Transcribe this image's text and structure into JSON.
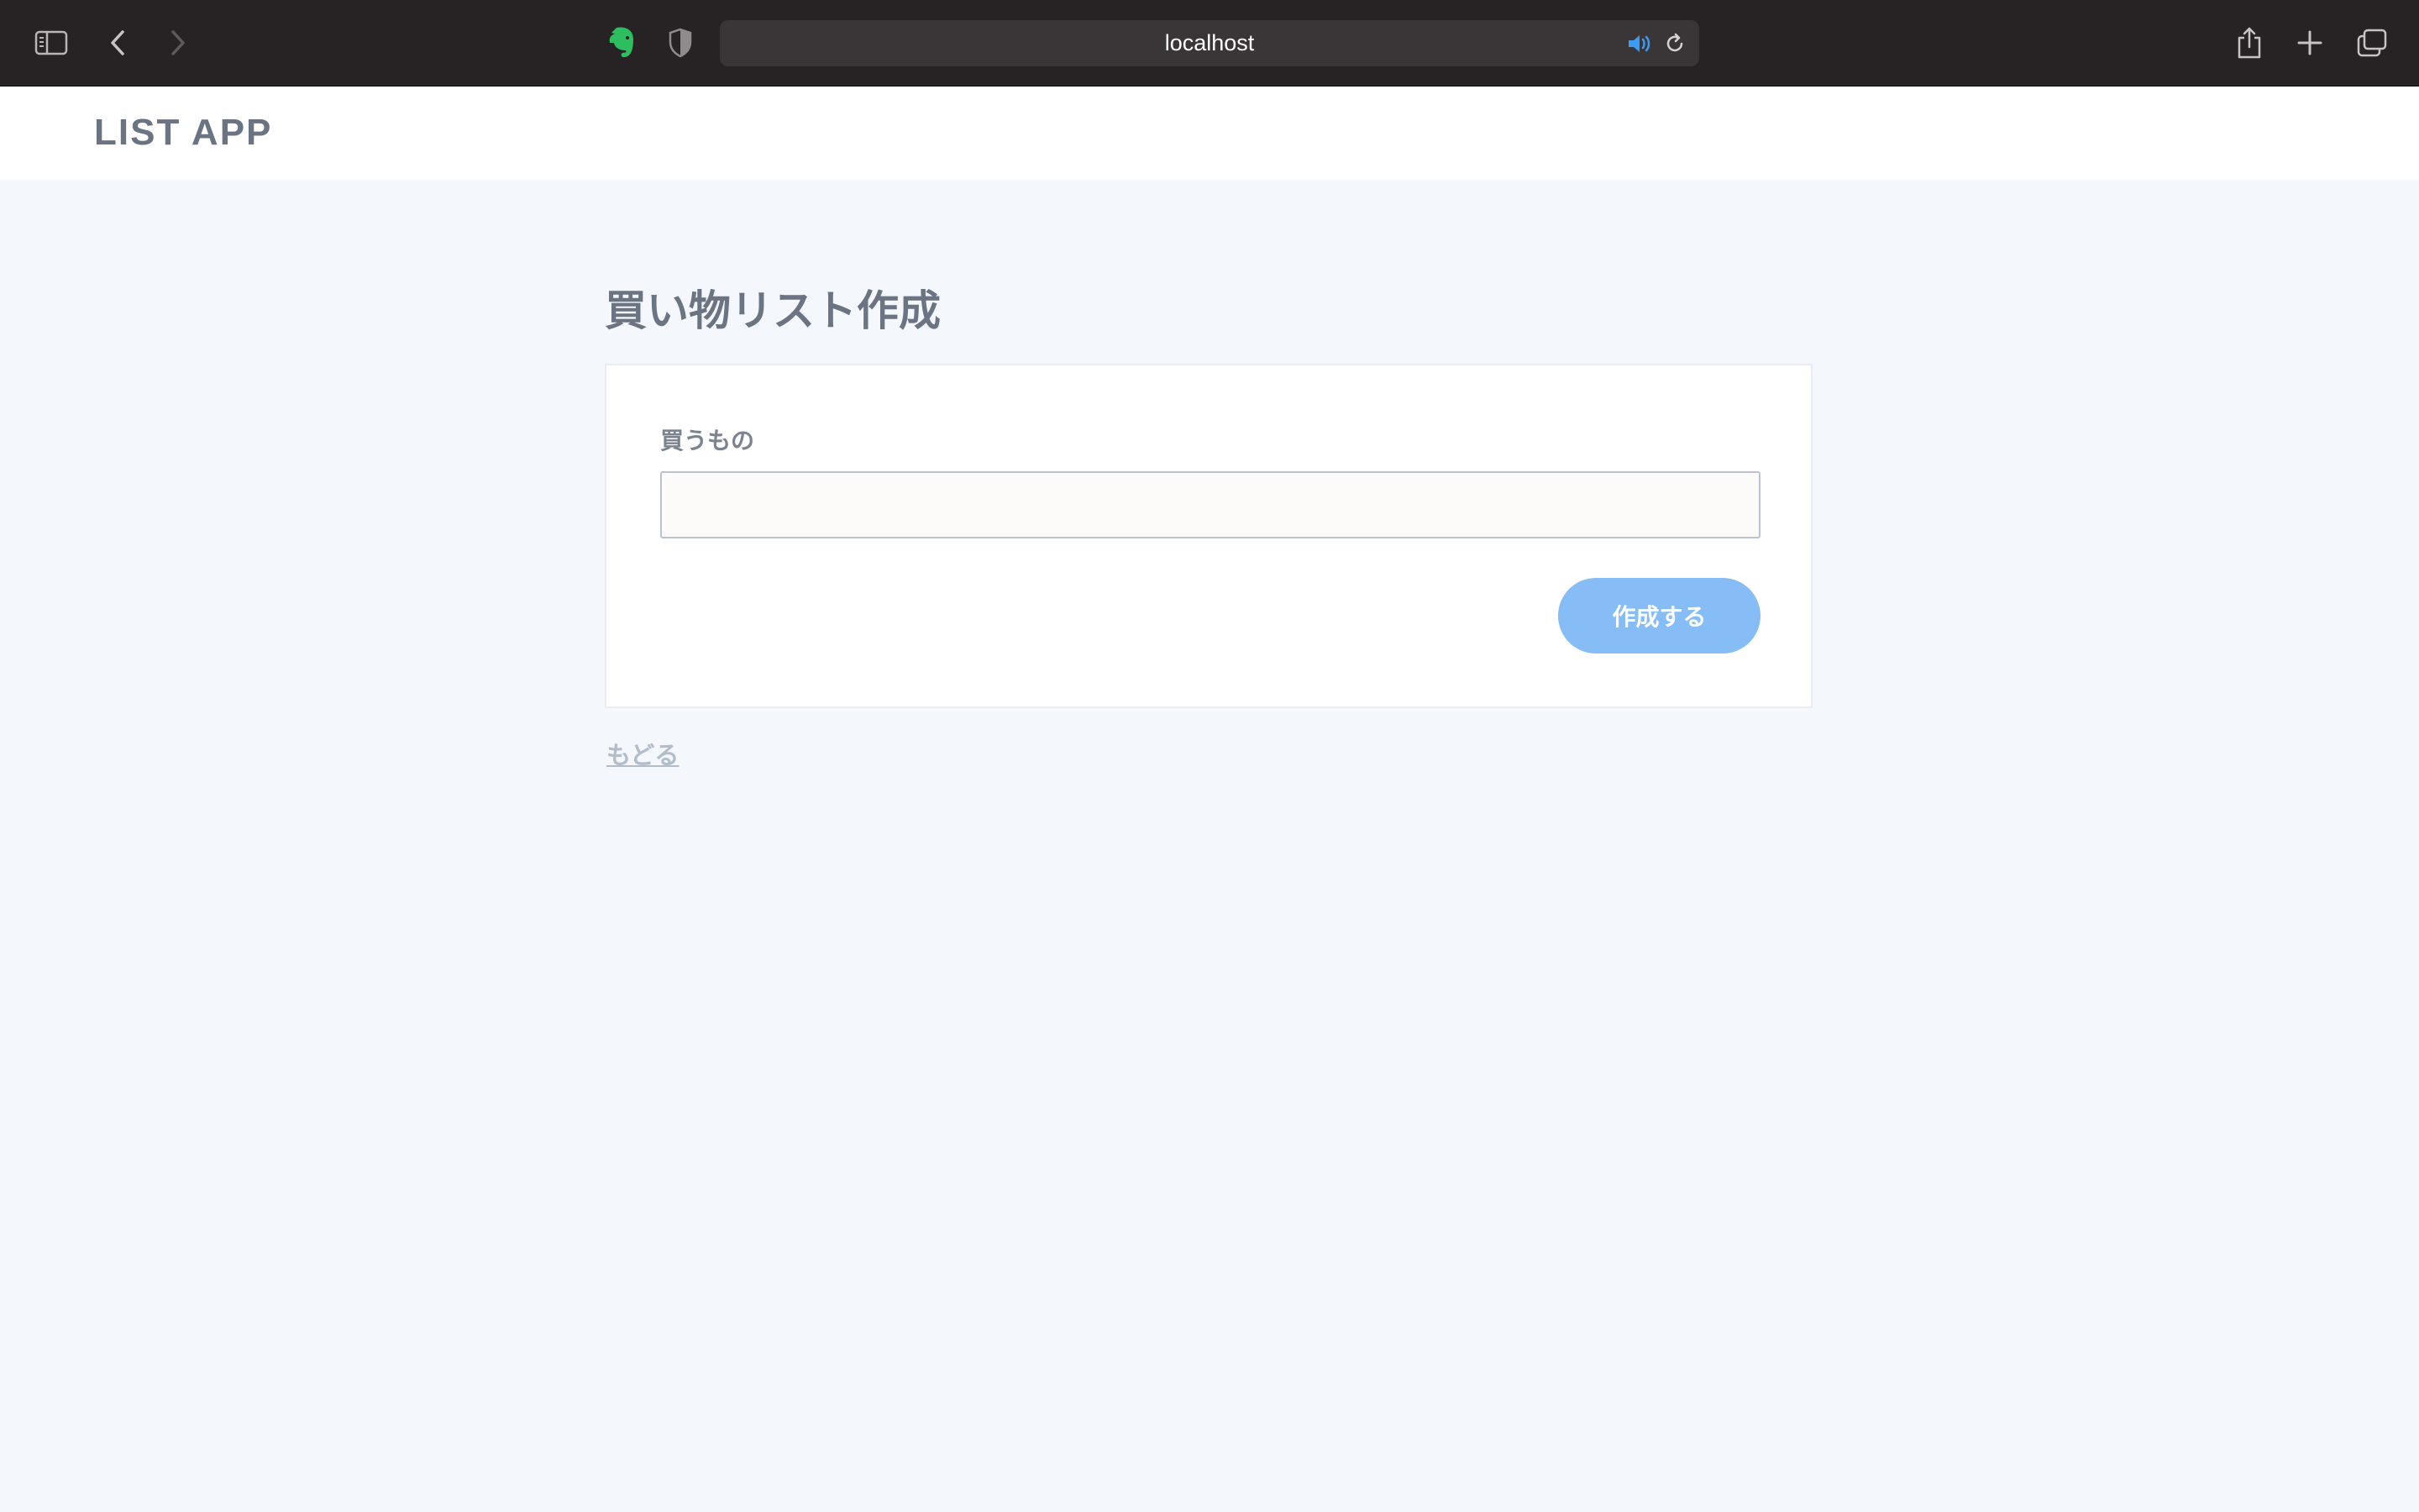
{
  "browser": {
    "url": "localhost",
    "icons": {
      "sidebar": "sidebar-toggle-icon",
      "back": "chevron-left-icon",
      "forward": "chevron-right-icon",
      "extension": "evernote-elephant-icon",
      "privacy": "shield-icon",
      "audio": "speaker-icon",
      "reload": "reload-icon",
      "share": "share-icon",
      "new_tab": "plus-icon",
      "tabs": "tab-overview-icon"
    },
    "colors": {
      "toolbar": "#272223",
      "url_bar": "#3a3638",
      "extension": "#2dbe60",
      "audio": "#3b9cf5"
    }
  },
  "app": {
    "title": "LIST APP"
  },
  "page": {
    "heading": "買い物リスト作成",
    "form": {
      "label": "買うもの",
      "input_value": "",
      "input_placeholder": "",
      "submit_label": "作成する"
    },
    "back_link": "もどる"
  },
  "colors": {
    "background": "#f4f8fc",
    "text": "#6b7482",
    "button": "#86bdf6",
    "link": "#b3bccb"
  }
}
